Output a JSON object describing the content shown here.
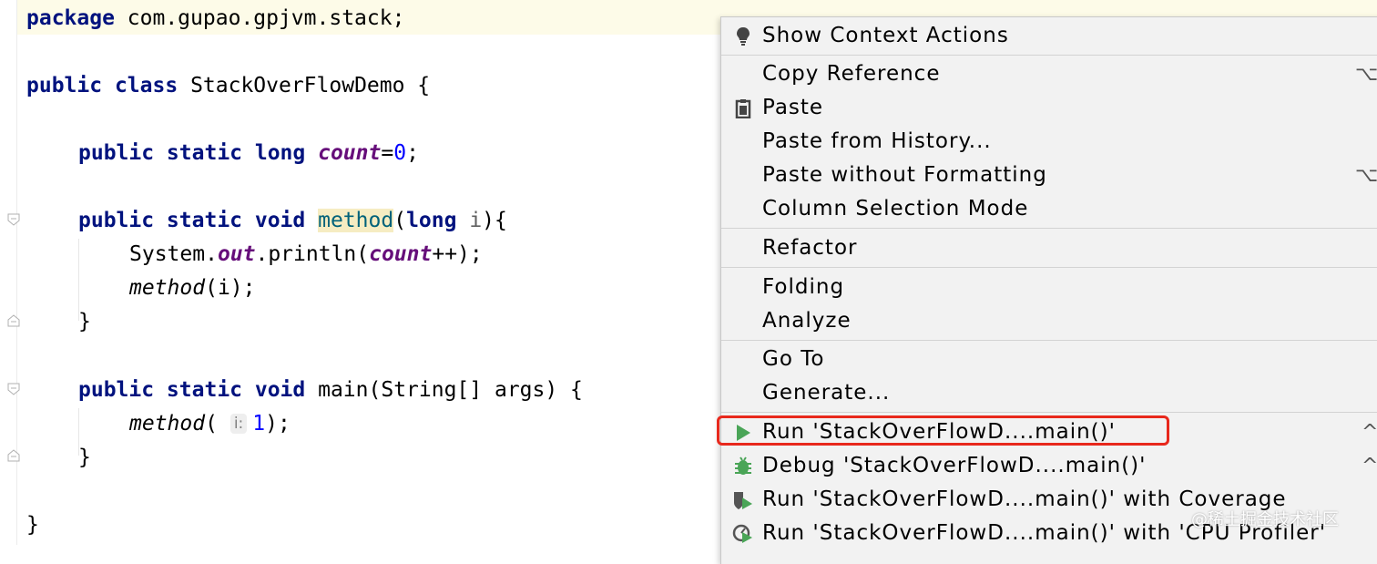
{
  "editor": {
    "package_kw": "package",
    "package_name": "com.gupao.gpjvm.stack;",
    "class_kw1": "public",
    "class_kw2": "class",
    "class_name": "StackOverFlowDemo {",
    "field_kw": "public static long",
    "field_name": "count",
    "field_eq": "=",
    "field_val": "0",
    "field_end": ";",
    "method_kw": "public static void",
    "method_name": "method",
    "method_paren": "(",
    "method_param_type": "long",
    "method_param_name": "i",
    "method_close": "){",
    "println_pre": "System.",
    "println_out": "out",
    "println_mid": ".println(",
    "println_count": "count",
    "println_end": "++);",
    "recursive_call": "method",
    "recursive_args": "(i);",
    "close_brace1": "}",
    "main_kw": "public static void",
    "main_sig": "main(String[] args) {",
    "main_call": "method",
    "main_paren_open": "(",
    "hint_label": "i:",
    "main_arg": "1",
    "main_paren_close": ");",
    "close_brace2": "}",
    "close_brace3": "}"
  },
  "context_menu": {
    "items": [
      {
        "label": "Show Context Actions",
        "icon": "lightbulb-icon",
        "shortcut": ""
      },
      {
        "label": "Copy Reference",
        "icon": "",
        "shortcut": "⌥"
      },
      {
        "label": "Paste",
        "icon": "clipboard-icon",
        "shortcut": ""
      },
      {
        "label": "Paste from History...",
        "icon": "",
        "shortcut": ""
      },
      {
        "label": "Paste without Formatting",
        "icon": "",
        "shortcut": "⌥"
      },
      {
        "label": "Column Selection Mode",
        "icon": "",
        "shortcut": ""
      },
      {
        "label": "Refactor",
        "icon": "",
        "shortcut": ""
      },
      {
        "label": "Folding",
        "icon": "",
        "shortcut": ""
      },
      {
        "label": "Analyze",
        "icon": "",
        "shortcut": ""
      },
      {
        "label": "Go To",
        "icon": "",
        "shortcut": ""
      },
      {
        "label": "Generate...",
        "icon": "",
        "shortcut": ""
      },
      {
        "label": "Run 'StackOverFlowD....main()'",
        "icon": "run-icon",
        "shortcut": "^"
      },
      {
        "label": "Debug 'StackOverFlowD....main()'",
        "icon": "debug-icon",
        "shortcut": "^"
      },
      {
        "label": "Run 'StackOverFlowD....main()' with Coverage",
        "icon": "coverage-icon",
        "shortcut": ""
      },
      {
        "label": "Run 'StackOverFlowD....main()' with 'CPU Profiler'",
        "icon": "profiler-icon",
        "shortcut": ""
      }
    ]
  },
  "watermark": "@稀土掘金技术社区",
  "colors": {
    "keyword": "#00127e",
    "field": "#660e7a",
    "number": "#0000ff",
    "highlight_box": "#e8281c",
    "run_green": "#4aa557"
  }
}
